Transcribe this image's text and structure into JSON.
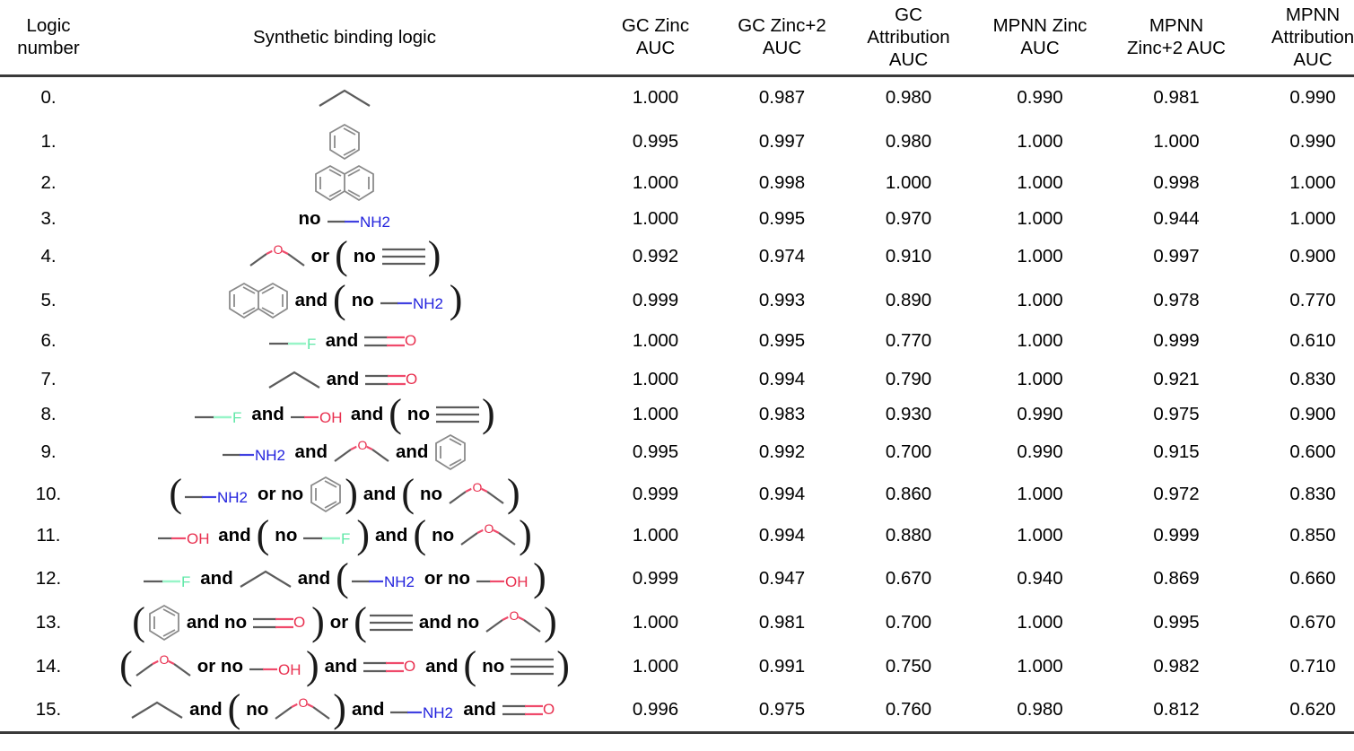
{
  "table": {
    "headers": [
      "Logic\nnumber",
      "Synthetic binding logic",
      "GC Zinc\nAUC",
      "GC Zinc+2\nAUC",
      "GC\nAttribution\nAUC",
      "MPNN Zinc\nAUC",
      "MPNN\nZinc+2 AUC",
      "MPNN\nAttribution\nAUC"
    ],
    "header_lines": {
      "logic_number": [
        "Logic",
        "number"
      ],
      "synthetic_binding_logic": [
        "Synthetic binding logic"
      ],
      "gc_zinc_auc": [
        "GC Zinc",
        "AUC"
      ],
      "gc_zinc2_auc": [
        "GC Zinc+2",
        "AUC"
      ],
      "gc_attribution_auc": [
        "GC",
        "Attribution",
        "AUC"
      ],
      "mpnn_zinc_auc": [
        "MPNN Zinc",
        "AUC"
      ],
      "mpnn_zinc2_auc": [
        "MPNN",
        "Zinc+2 AUC"
      ],
      "mpnn_attribution_auc": [
        "MPNN",
        "Attribution",
        "AUC"
      ]
    },
    "rows": [
      {
        "number": "0.",
        "logic_text": "alkane",
        "gc_zinc_auc": "1.000",
        "gc_zinc2_auc": "0.987",
        "gc_attribution_auc": "0.980",
        "mpnn_zinc_auc": "0.990",
        "mpnn_zinc2_auc": "0.981",
        "mpnn_attribution_auc": "0.990"
      },
      {
        "number": "1.",
        "logic_text": "benzene",
        "gc_zinc_auc": "0.995",
        "gc_zinc2_auc": "0.997",
        "gc_attribution_auc": "0.980",
        "mpnn_zinc_auc": "1.000",
        "mpnn_zinc2_auc": "1.000",
        "mpnn_attribution_auc": "0.990"
      },
      {
        "number": "2.",
        "logic_text": "naphthalene",
        "gc_zinc_auc": "1.000",
        "gc_zinc2_auc": "0.998",
        "gc_attribution_auc": "1.000",
        "mpnn_zinc_auc": "1.000",
        "mpnn_zinc2_auc": "0.998",
        "mpnn_attribution_auc": "1.000"
      },
      {
        "number": "3.",
        "logic_text": "no NH2",
        "gc_zinc_auc": "1.000",
        "gc_zinc2_auc": "0.995",
        "gc_attribution_auc": "0.970",
        "mpnn_zinc_auc": "1.000",
        "mpnn_zinc2_auc": "0.944",
        "mpnn_attribution_auc": "1.000"
      },
      {
        "number": "4.",
        "logic_text": "ether or (no alkyne)",
        "gc_zinc_auc": "0.992",
        "gc_zinc2_auc": "0.974",
        "gc_attribution_auc": "0.910",
        "mpnn_zinc_auc": "1.000",
        "mpnn_zinc2_auc": "0.997",
        "mpnn_attribution_auc": "0.900"
      },
      {
        "number": "5.",
        "logic_text": "naphthalene and (no NH2)",
        "gc_zinc_auc": "0.999",
        "gc_zinc2_auc": "0.993",
        "gc_attribution_auc": "0.890",
        "mpnn_zinc_auc": "1.000",
        "mpnn_zinc2_auc": "0.978",
        "mpnn_attribution_auc": "0.770"
      },
      {
        "number": "6.",
        "logic_text": "F and carbonyl",
        "gc_zinc_auc": "1.000",
        "gc_zinc2_auc": "0.995",
        "gc_attribution_auc": "0.770",
        "mpnn_zinc_auc": "1.000",
        "mpnn_zinc2_auc": "0.999",
        "mpnn_attribution_auc": "0.610"
      },
      {
        "number": "7.",
        "logic_text": "alkane and carbonyl",
        "gc_zinc_auc": "1.000",
        "gc_zinc2_auc": "0.994",
        "gc_attribution_auc": "0.790",
        "mpnn_zinc_auc": "1.000",
        "mpnn_zinc2_auc": "0.921",
        "mpnn_attribution_auc": "0.830"
      },
      {
        "number": "8.",
        "logic_text": "F and OH and (no alkyne)",
        "gc_zinc_auc": "1.000",
        "gc_zinc2_auc": "0.983",
        "gc_attribution_auc": "0.930",
        "mpnn_zinc_auc": "0.990",
        "mpnn_zinc2_auc": "0.975",
        "mpnn_attribution_auc": "0.900"
      },
      {
        "number": "9.",
        "logic_text": "NH2 and ether and benzene",
        "gc_zinc_auc": "0.995",
        "gc_zinc2_auc": "0.992",
        "gc_attribution_auc": "0.700",
        "mpnn_zinc_auc": "0.990",
        "mpnn_zinc2_auc": "0.915",
        "mpnn_attribution_auc": "0.600"
      },
      {
        "number": "10.",
        "logic_text": "(NH2 or no benzene) and (no ether)",
        "gc_zinc_auc": "0.999",
        "gc_zinc2_auc": "0.994",
        "gc_attribution_auc": "0.860",
        "mpnn_zinc_auc": "1.000",
        "mpnn_zinc2_auc": "0.972",
        "mpnn_attribution_auc": "0.830"
      },
      {
        "number": "11.",
        "logic_text": "OH and (no F) and (no ether)",
        "gc_zinc_auc": "1.000",
        "gc_zinc2_auc": "0.994",
        "gc_attribution_auc": "0.880",
        "mpnn_zinc_auc": "1.000",
        "mpnn_zinc2_auc": "0.999",
        "mpnn_attribution_auc": "0.850"
      },
      {
        "number": "12.",
        "logic_text": "F and alkane and (NH2 or no OH)",
        "gc_zinc_auc": "0.999",
        "gc_zinc2_auc": "0.947",
        "gc_attribution_auc": "0.670",
        "mpnn_zinc_auc": "0.940",
        "mpnn_zinc2_auc": "0.869",
        "mpnn_attribution_auc": "0.660"
      },
      {
        "number": "13.",
        "logic_text": "(benzene and no carbonyl) or (alkyne and no ether)",
        "gc_zinc_auc": "1.000",
        "gc_zinc2_auc": "0.981",
        "gc_attribution_auc": "0.700",
        "mpnn_zinc_auc": "1.000",
        "mpnn_zinc2_auc": "0.995",
        "mpnn_attribution_auc": "0.670"
      },
      {
        "number": "14.",
        "logic_text": "(ether or no OH) and carbonyl and (no alkyne)",
        "gc_zinc_auc": "1.000",
        "gc_zinc2_auc": "0.991",
        "gc_attribution_auc": "0.750",
        "mpnn_zinc_auc": "1.000",
        "mpnn_zinc2_auc": "0.982",
        "mpnn_attribution_auc": "0.710"
      },
      {
        "number": "15.",
        "logic_text": "alkane and (no ether) and NH2 and carbonyl",
        "gc_zinc_auc": "0.996",
        "gc_zinc2_auc": "0.975",
        "gc_attribution_auc": "0.760",
        "mpnn_zinc_auc": "0.980",
        "mpnn_zinc2_auc": "0.812",
        "mpnn_attribution_auc": "0.620"
      }
    ]
  },
  "keywords": {
    "and": "and",
    "or": "or",
    "no": "no",
    "and_no": "and no",
    "or_no": "or no",
    "paren_open": "(",
    "paren_close": ")"
  },
  "fragment_labels": {
    "NH2": "NH2",
    "OH": "OH",
    "O": "O",
    "F": "F"
  },
  "colors": {
    "nitrogen": "#2222dd",
    "oxygen": "#e8304f",
    "fluorine": "#62e8a8",
    "bond_gray": "#5c5c5c",
    "bond_red": "#ef4a6b",
    "ring_gray": "#8a8a8a",
    "rule": "#3a3a3a",
    "text": "#000000",
    "background": "#ffffff"
  }
}
